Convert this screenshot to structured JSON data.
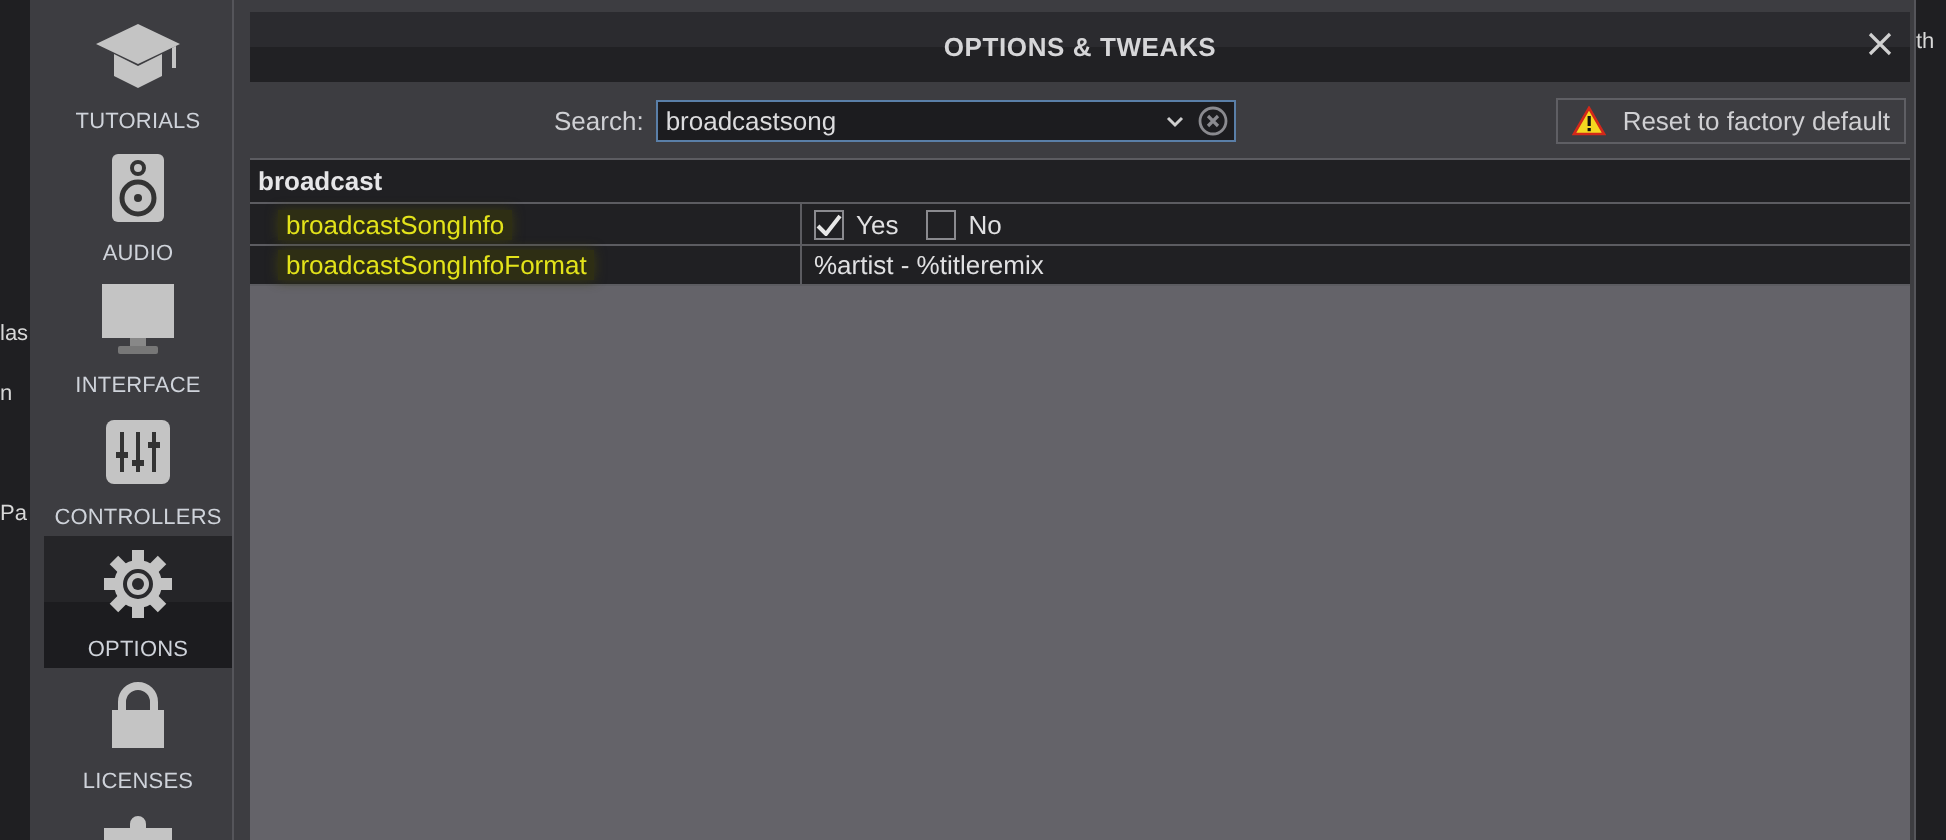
{
  "background_app": {
    "left_fragments": [
      "las",
      "n",
      "Pa"
    ],
    "right_fragments": [
      "th"
    ]
  },
  "sidebar": {
    "items": [
      {
        "kind": "cap",
        "label": "TUTORIALS",
        "selected": false
      },
      {
        "kind": "speaker",
        "label": "AUDIO",
        "selected": false
      },
      {
        "kind": "monitor",
        "label": "INTERFACE",
        "selected": false
      },
      {
        "kind": "sliders",
        "label": "CONTROLLERS",
        "selected": false
      },
      {
        "kind": "gear",
        "label": "OPTIONS",
        "selected": true
      },
      {
        "kind": "lock",
        "label": "LICENSES",
        "selected": false
      },
      {
        "kind": "puzzle",
        "selected": false
      }
    ]
  },
  "dialog": {
    "title": "OPTIONS & TWEAKS"
  },
  "search": {
    "label": "Search:",
    "value": "broadcastsong"
  },
  "reset_button": {
    "label": "Reset to factory default"
  },
  "table": {
    "group": "broadcast",
    "rows": [
      {
        "name": "broadcastSongInfo",
        "highlighted": true,
        "kind": "choice",
        "options": [
          {
            "label": "Yes",
            "checked": true
          },
          {
            "label": "No",
            "checked": false
          }
        ]
      },
      {
        "name": "broadcastSongInfoFormat",
        "highlighted": true,
        "kind": "text",
        "value": "%artist - %titleremix"
      }
    ]
  }
}
